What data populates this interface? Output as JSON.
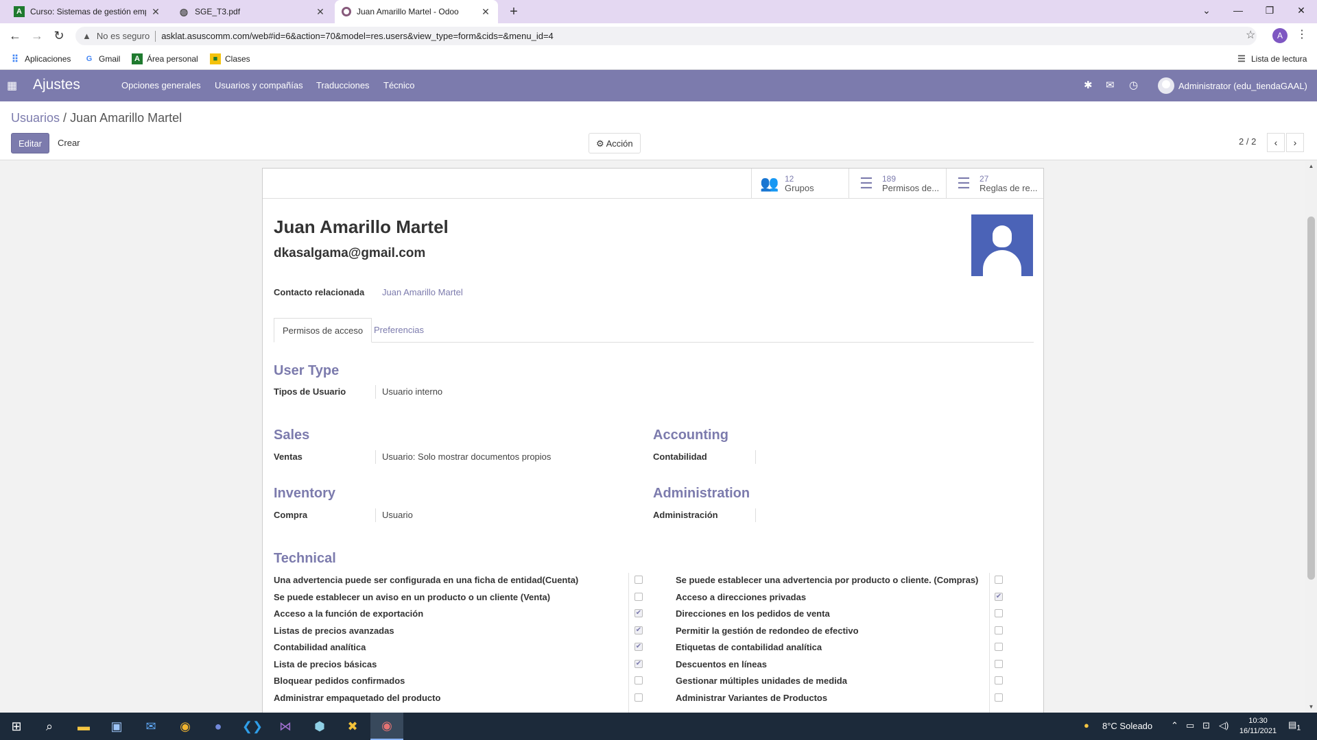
{
  "browser": {
    "tabs": [
      {
        "title": "Curso: Sistemas de gestión empr",
        "favicon": "A"
      },
      {
        "title": "SGE_T3.pdf",
        "favicon": "globe"
      },
      {
        "title": "Juan Amarillo Martel - Odoo",
        "favicon": "odoo"
      }
    ],
    "security_label": "No es seguro",
    "url": "asklat.asuscomm.com/web#id=6&action=70&model=res.users&view_type=form&cids=&menu_id=4",
    "profile_initial": "A",
    "bookmarks": [
      "Aplicaciones",
      "Gmail",
      "Área personal",
      "Clases"
    ],
    "reading_list": "Lista de lectura"
  },
  "odoo": {
    "app_name": "Ajustes",
    "menu": [
      "Opciones generales",
      "Usuarios y compañías",
      "Traducciones",
      "Técnico"
    ],
    "user_label": "Administrator (edu_tiendaGAAL)",
    "accent_color": "#7c7bad"
  },
  "control_panel": {
    "breadcrumb_parent": "Usuarios",
    "breadcrumb_sep": "/",
    "breadcrumb_current": "Juan Amarillo Martel",
    "edit_label": "Editar",
    "create_label": "Crear",
    "action_label": "Acción",
    "pager": "2 / 2"
  },
  "form": {
    "stat_buttons": [
      {
        "count": "12",
        "label": "Grupos",
        "icon": "users-icon"
      },
      {
        "count": "189",
        "label": "Permisos de...",
        "icon": "list-icon"
      },
      {
        "count": "27",
        "label": "Reglas de re...",
        "icon": "list-icon"
      }
    ],
    "name": "Juan Amarillo Martel",
    "login": "dkasalgama@gmail.com",
    "related_contact_label": "Contacto relacionada",
    "related_contact_value": "Juan Amarillo Martel",
    "tabs": [
      "Permisos de acceso",
      "Preferencias"
    ],
    "user_type_title": "User Type",
    "user_type_label": "Tipos de Usuario",
    "user_type_value": "Usuario interno",
    "sales_title": "Sales",
    "sales_label": "Ventas",
    "sales_value": "Usuario: Solo mostrar documentos propios",
    "accounting_title": "Accounting",
    "accounting_label": "Contabilidad",
    "accounting_value": "",
    "inventory_title": "Inventory",
    "inventory_label": "Compra",
    "inventory_value": "Usuario",
    "administration_title": "Administration",
    "administration_label": "Administración",
    "administration_value": "",
    "technical_title": "Technical",
    "technical_left": [
      {
        "label": "Una advertencia puede ser configurada en una ficha de entidad(Cuenta)",
        "checked": false
      },
      {
        "label": "Se puede establecer un aviso en un producto o un cliente (Venta)",
        "checked": false
      },
      {
        "label": "Acceso a la función de exportación",
        "checked": true
      },
      {
        "label": "Listas de precios avanzadas",
        "checked": true
      },
      {
        "label": "Contabilidad analítica",
        "checked": true
      },
      {
        "label": "Lista de precios básicas",
        "checked": true
      },
      {
        "label": "Bloquear pedidos confirmados",
        "checked": false
      },
      {
        "label": "Administrar empaquetado del producto",
        "checked": false
      }
    ],
    "technical_right": [
      {
        "label": "Se puede establecer una advertencia por producto o cliente. (Compras)",
        "checked": false
      },
      {
        "label": "Acceso a direcciones privadas",
        "checked": true
      },
      {
        "label": "Direcciones en los pedidos de venta",
        "checked": false
      },
      {
        "label": "Permitir la gestión de redondeo de efectivo",
        "checked": false
      },
      {
        "label": "Etiquetas de contabilidad analítica",
        "checked": false
      },
      {
        "label": "Descuentos en líneas",
        "checked": false
      },
      {
        "label": "Gestionar múltiples unidades de medida",
        "checked": false
      },
      {
        "label": "Administrar Variantes de Productos",
        "checked": false
      }
    ]
  },
  "taskbar": {
    "weather": "8°C Soleado",
    "time": "10:30",
    "date": "16/11/2021",
    "notification_count": "1"
  }
}
